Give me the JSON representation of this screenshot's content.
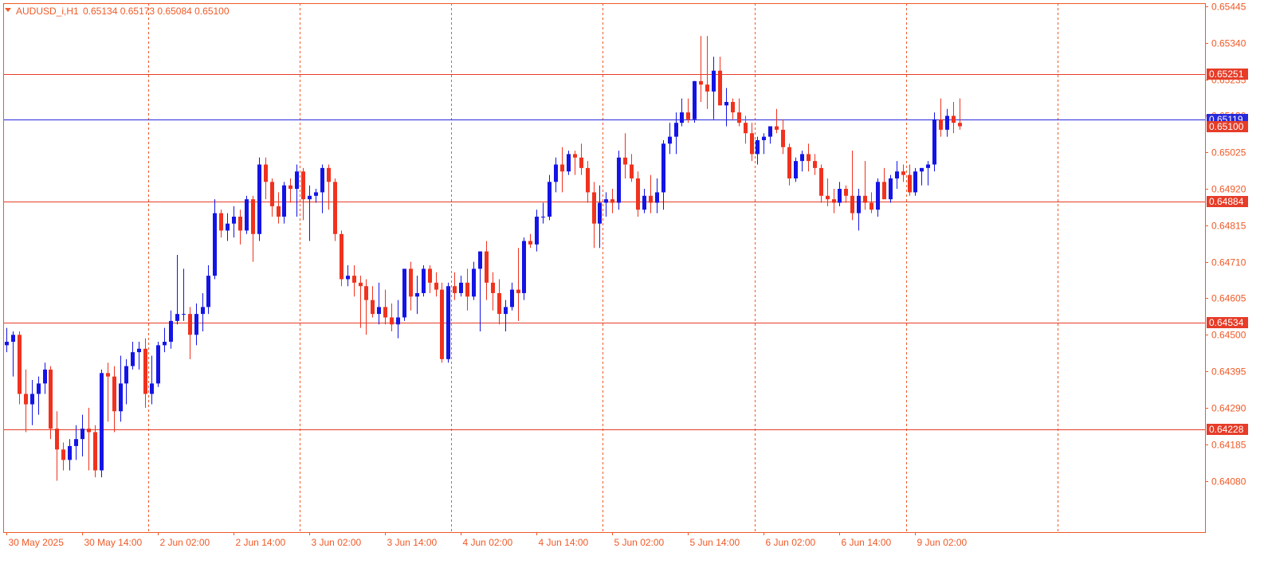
{
  "header": {
    "symbol": "AUDUSD_i,H1",
    "ohlc": "0.65134 0.65173 0.65084 0.65100"
  },
  "colors": {
    "bull": "#1414e6",
    "bear": "#f0321e",
    "axis": "#f05a28",
    "grid": "#f05a28",
    "hline": "#e63c28",
    "bidline": "#2828dc"
  },
  "chart_data": {
    "type": "candlestick",
    "title": "",
    "ylim": [
      0.6404,
      0.65445
    ],
    "y_ticks": [
      "0.65445",
      "0.65340",
      "0.65235",
      "0.65130",
      "0.65025",
      "0.64920",
      "0.64815",
      "0.64710",
      "0.64605",
      "0.64500",
      "0.64395",
      "0.64290",
      "0.64185",
      "0.64080"
    ],
    "x_ticks": [
      {
        "label": "30 May 2025",
        "bar": 0
      },
      {
        "label": "30 May 14:00",
        "bar": 12
      },
      {
        "label": "2 Jun 02:00",
        "bar": 24
      },
      {
        "label": "2 Jun 14:00",
        "bar": 36
      },
      {
        "label": "3 Jun 02:00",
        "bar": 48
      },
      {
        "label": "3 Jun 14:00",
        "bar": 60
      },
      {
        "label": "4 Jun 02:00",
        "bar": 72
      },
      {
        "label": "4 Jun 14:00",
        "bar": 84
      },
      {
        "label": "5 Jun 02:00",
        "bar": 96
      },
      {
        "label": "5 Jun 14:00",
        "bar": 108
      },
      {
        "label": "6 Jun 02:00",
        "bar": 120
      },
      {
        "label": "6 Jun 14:00",
        "bar": 132
      },
      {
        "label": "9 Jun 02:00",
        "bar": 144
      }
    ],
    "period_separators": [
      22,
      46,
      70,
      94,
      118,
      142,
      166
    ],
    "horizontal_levels": [
      {
        "label": "0.65251",
        "value": 0.65251
      },
      {
        "label": "0.64884",
        "value": 0.64884
      },
      {
        "label": "0.64534",
        "value": 0.64534
      },
      {
        "label": "0.64228",
        "value": 0.64228
      }
    ],
    "bid_line": {
      "label": "0.65119",
      "value": 0.65119
    },
    "last_price": {
      "label": "0.65100",
      "value": 0.651
    },
    "ohlc": [
      [
        0.6447,
        0.6452,
        0.6445,
        0.6448
      ],
      [
        0.6448,
        0.6451,
        0.6438,
        0.645
      ],
      [
        0.645,
        0.6451,
        0.643,
        0.6433
      ],
      [
        0.6433,
        0.644,
        0.6422,
        0.643
      ],
      [
        0.643,
        0.6437,
        0.6424,
        0.6433
      ],
      [
        0.6433,
        0.6438,
        0.6427,
        0.6436
      ],
      [
        0.6436,
        0.6442,
        0.6433,
        0.644
      ],
      [
        0.644,
        0.6441,
        0.642,
        0.6423
      ],
      [
        0.6423,
        0.6428,
        0.6408,
        0.6417
      ],
      [
        0.6417,
        0.6419,
        0.6411,
        0.6414
      ],
      [
        0.6414,
        0.642,
        0.6411,
        0.6418
      ],
      [
        0.6418,
        0.6424,
        0.6414,
        0.642
      ],
      [
        0.642,
        0.6427,
        0.6415,
        0.6423
      ],
      [
        0.6423,
        0.6429,
        0.6411,
        0.6422
      ],
      [
        0.6422,
        0.6424,
        0.6409,
        0.6411
      ],
      [
        0.6411,
        0.644,
        0.6409,
        0.6439
      ],
      [
        0.6439,
        0.6442,
        0.6425,
        0.6438
      ],
      [
        0.6438,
        0.6441,
        0.6422,
        0.6428
      ],
      [
        0.6428,
        0.6444,
        0.6425,
        0.6436
      ],
      [
        0.6436,
        0.6443,
        0.643,
        0.6441
      ],
      [
        0.6441,
        0.6448,
        0.644,
        0.6445
      ],
      [
        0.6445,
        0.6448,
        0.644,
        0.6446
      ],
      [
        0.6446,
        0.6449,
        0.6429,
        0.6433
      ],
      [
        0.6433,
        0.6444,
        0.643,
        0.6436
      ],
      [
        0.6436,
        0.6448,
        0.6435,
        0.6447
      ],
      [
        0.6447,
        0.6452,
        0.6445,
        0.6448
      ],
      [
        0.6448,
        0.6457,
        0.6446,
        0.6454
      ],
      [
        0.6454,
        0.6473,
        0.6453,
        0.6456
      ],
      [
        0.6456,
        0.6469,
        0.6454,
        0.6456
      ],
      [
        0.6456,
        0.6458,
        0.6443,
        0.645
      ],
      [
        0.645,
        0.6459,
        0.6447,
        0.6456
      ],
      [
        0.6456,
        0.6462,
        0.6451,
        0.6458
      ],
      [
        0.6458,
        0.647,
        0.6456,
        0.6467
      ],
      [
        0.6467,
        0.6489,
        0.6466,
        0.6485
      ],
      [
        0.6485,
        0.6486,
        0.6478,
        0.648
      ],
      [
        0.648,
        0.6485,
        0.6477,
        0.6482
      ],
      [
        0.6482,
        0.6487,
        0.6478,
        0.6484
      ],
      [
        0.6484,
        0.6486,
        0.6476,
        0.648
      ],
      [
        0.648,
        0.649,
        0.6479,
        0.6489
      ],
      [
        0.6489,
        0.649,
        0.6471,
        0.6479
      ],
      [
        0.6479,
        0.6501,
        0.6477,
        0.6499
      ],
      [
        0.6499,
        0.6501,
        0.6489,
        0.6494
      ],
      [
        0.6494,
        0.6495,
        0.6484,
        0.6487
      ],
      [
        0.6487,
        0.6491,
        0.6482,
        0.6484
      ],
      [
        0.6484,
        0.6494,
        0.6482,
        0.6493
      ],
      [
        0.6493,
        0.6495,
        0.6488,
        0.6492
      ],
      [
        0.6492,
        0.6499,
        0.6484,
        0.6497
      ],
      [
        0.6497,
        0.6498,
        0.6483,
        0.6489
      ],
      [
        0.6489,
        0.6493,
        0.6477,
        0.649
      ],
      [
        0.649,
        0.6492,
        0.6488,
        0.6491
      ],
      [
        0.6491,
        0.6499,
        0.6485,
        0.6498
      ],
      [
        0.6498,
        0.6499,
        0.6486,
        0.6494
      ],
      [
        0.6494,
        0.6495,
        0.6477,
        0.6479
      ],
      [
        0.6479,
        0.648,
        0.6464,
        0.6466
      ],
      [
        0.6466,
        0.647,
        0.6464,
        0.6467
      ],
      [
        0.6467,
        0.647,
        0.6461,
        0.6465
      ],
      [
        0.6465,
        0.6467,
        0.6452,
        0.6464
      ],
      [
        0.6464,
        0.6466,
        0.645,
        0.646
      ],
      [
        0.646,
        0.6464,
        0.6455,
        0.6456
      ],
      [
        0.6456,
        0.6465,
        0.6453,
        0.6458
      ],
      [
        0.6458,
        0.6463,
        0.6453,
        0.6455
      ],
      [
        0.6455,
        0.6459,
        0.6451,
        0.6453
      ],
      [
        0.6453,
        0.646,
        0.6449,
        0.6455
      ],
      [
        0.6455,
        0.6466,
        0.6454,
        0.6469
      ],
      [
        0.6469,
        0.6471,
        0.6457,
        0.6461
      ],
      [
        0.6461,
        0.6467,
        0.6456,
        0.6462
      ],
      [
        0.6462,
        0.647,
        0.6461,
        0.6469
      ],
      [
        0.6469,
        0.647,
        0.6462,
        0.6465
      ],
      [
        0.6465,
        0.6468,
        0.6461,
        0.6463
      ],
      [
        0.6463,
        0.6465,
        0.6442,
        0.6443
      ],
      [
        0.6443,
        0.6465,
        0.6442,
        0.6464
      ],
      [
        0.6464,
        0.6468,
        0.646,
        0.6462
      ],
      [
        0.6462,
        0.6467,
        0.6461,
        0.6465
      ],
      [
        0.6465,
        0.6469,
        0.6457,
        0.6461
      ],
      [
        0.6461,
        0.6471,
        0.646,
        0.6469
      ],
      [
        0.6469,
        0.6474,
        0.6451,
        0.6474
      ],
      [
        0.6474,
        0.6477,
        0.646,
        0.6465
      ],
      [
        0.6465,
        0.6468,
        0.6457,
        0.6462
      ],
      [
        0.6462,
        0.6466,
        0.6453,
        0.6456
      ],
      [
        0.6456,
        0.646,
        0.6451,
        0.6458
      ],
      [
        0.6458,
        0.6465,
        0.6457,
        0.6463
      ],
      [
        0.6463,
        0.6475,
        0.6454,
        0.6462
      ],
      [
        0.6462,
        0.6478,
        0.646,
        0.6477
      ],
      [
        0.6477,
        0.6479,
        0.6475,
        0.6476
      ],
      [
        0.6476,
        0.6486,
        0.6474,
        0.6484
      ],
      [
        0.6484,
        0.6488,
        0.6482,
        0.6484
      ],
      [
        0.6484,
        0.6496,
        0.6483,
        0.6494
      ],
      [
        0.6494,
        0.6501,
        0.6491,
        0.6499
      ],
      [
        0.6499,
        0.6504,
        0.6491,
        0.6497
      ],
      [
        0.6497,
        0.6503,
        0.6496,
        0.6502
      ],
      [
        0.6502,
        0.6503,
        0.6496,
        0.6501
      ],
      [
        0.6501,
        0.6505,
        0.6496,
        0.6498
      ],
      [
        0.6498,
        0.65,
        0.6488,
        0.6491
      ],
      [
        0.6491,
        0.6494,
        0.6475,
        0.6482
      ],
      [
        0.6482,
        0.6493,
        0.6475,
        0.6488
      ],
      [
        0.6488,
        0.6491,
        0.6484,
        0.6489
      ],
      [
        0.6489,
        0.6492,
        0.6485,
        0.6488
      ],
      [
        0.6488,
        0.6503,
        0.6486,
        0.6501
      ],
      [
        0.6501,
        0.6508,
        0.6495,
        0.6499
      ],
      [
        0.6499,
        0.6502,
        0.6494,
        0.6495
      ],
      [
        0.6495,
        0.6497,
        0.6484,
        0.6486
      ],
      [
        0.6486,
        0.6492,
        0.6485,
        0.649
      ],
      [
        0.649,
        0.6496,
        0.6485,
        0.6488
      ],
      [
        0.6488,
        0.6495,
        0.6485,
        0.6491
      ],
      [
        0.6491,
        0.6506,
        0.6486,
        0.6505
      ],
      [
        0.6505,
        0.6511,
        0.6502,
        0.6507
      ],
      [
        0.6507,
        0.6514,
        0.6502,
        0.6511
      ],
      [
        0.6511,
        0.6518,
        0.651,
        0.6514
      ],
      [
        0.6514,
        0.6518,
        0.6511,
        0.6512
      ],
      [
        0.6512,
        0.6523,
        0.6511,
        0.6523
      ],
      [
        0.6523,
        0.6536,
        0.6517,
        0.6522
      ],
      [
        0.6522,
        0.6536,
        0.6515,
        0.652
      ],
      [
        0.652,
        0.653,
        0.6512,
        0.6526
      ],
      [
        0.6526,
        0.653,
        0.6516,
        0.6516
      ],
      [
        0.6516,
        0.6521,
        0.651,
        0.6517
      ],
      [
        0.6517,
        0.6518,
        0.6512,
        0.6514
      ],
      [
        0.6514,
        0.6518,
        0.651,
        0.6511
      ],
      [
        0.6511,
        0.6513,
        0.6505,
        0.6508
      ],
      [
        0.6508,
        0.6511,
        0.65,
        0.6502
      ],
      [
        0.6502,
        0.6507,
        0.6499,
        0.6506
      ],
      [
        0.6506,
        0.6508,
        0.6502,
        0.6507
      ],
      [
        0.6507,
        0.651,
        0.6505,
        0.651
      ],
      [
        0.651,
        0.6515,
        0.6508,
        0.6509
      ],
      [
        0.6509,
        0.6512,
        0.6502,
        0.6504
      ],
      [
        0.6504,
        0.6505,
        0.6493,
        0.6495
      ],
      [
        0.6495,
        0.6501,
        0.6494,
        0.65
      ],
      [
        0.65,
        0.6503,
        0.6497,
        0.6502
      ],
      [
        0.6502,
        0.6505,
        0.6497,
        0.65
      ],
      [
        0.65,
        0.6502,
        0.6496,
        0.6498
      ],
      [
        0.6498,
        0.6499,
        0.6488,
        0.649
      ],
      [
        0.649,
        0.6495,
        0.6487,
        0.6489
      ],
      [
        0.6489,
        0.6492,
        0.6485,
        0.6488
      ],
      [
        0.6488,
        0.6494,
        0.6487,
        0.6492
      ],
      [
        0.6492,
        0.6493,
        0.6488,
        0.649
      ],
      [
        0.649,
        0.6503,
        0.6483,
        0.6485
      ],
      [
        0.6485,
        0.6492,
        0.648,
        0.649
      ],
      [
        0.649,
        0.65,
        0.6486,
        0.6488
      ],
      [
        0.6488,
        0.6491,
        0.6485,
        0.6486
      ],
      [
        0.6486,
        0.6495,
        0.6484,
        0.6494
      ],
      [
        0.6494,
        0.6498,
        0.6489,
        0.6489
      ],
      [
        0.6489,
        0.6496,
        0.6488,
        0.6495
      ],
      [
        0.6495,
        0.65,
        0.6492,
        0.6497
      ],
      [
        0.6497,
        0.6499,
        0.6494,
        0.6496
      ],
      [
        0.6496,
        0.6499,
        0.649,
        0.6491
      ],
      [
        0.6491,
        0.6498,
        0.649,
        0.6497
      ],
      [
        0.6497,
        0.6498,
        0.6493,
        0.6498
      ],
      [
        0.6498,
        0.65,
        0.6493,
        0.6499
      ],
      [
        0.6499,
        0.6514,
        0.6497,
        0.6512
      ],
      [
        0.6512,
        0.6518,
        0.6507,
        0.6509
      ],
      [
        0.6509,
        0.6515,
        0.6507,
        0.6513
      ],
      [
        0.6513,
        0.6517,
        0.6508,
        0.6511
      ],
      [
        0.6511,
        0.6518,
        0.6509,
        0.651
      ]
    ]
  }
}
